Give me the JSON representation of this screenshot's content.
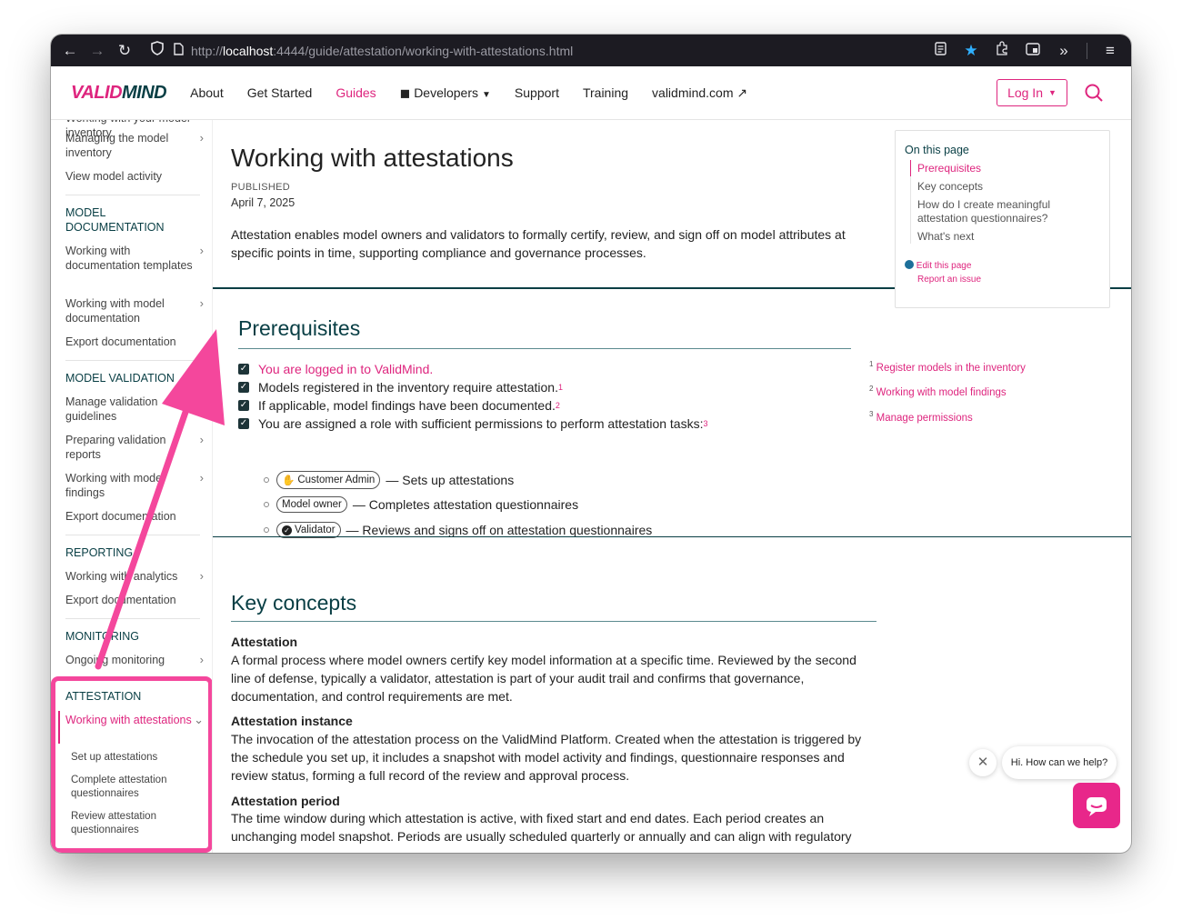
{
  "browser": {
    "url_prefix": "http://",
    "url_host": "localhost",
    "url_rest": ":4444/guide/attestation/working-with-attestations.html"
  },
  "header": {
    "logo_main": "VALID",
    "logo_second": "MIND",
    "nav": {
      "about": "About",
      "get_started": "Get Started",
      "guides": "Guides",
      "developers": "Developers",
      "support": "Support",
      "training": "Training",
      "validmind": "validmind.com"
    },
    "login": "Log In"
  },
  "sidebar": {
    "cut_top": "Working with your model inventory",
    "managing": "Managing the model inventory",
    "view_activity": "View model activity",
    "sec_model_doc": "MODEL DOCUMENTATION",
    "doc_templates": "Working with documentation templates",
    "model_doc": "Working with model documentation",
    "export_doc": "Export documentation",
    "sec_model_val": "MODEL VALIDATION",
    "manage_val": "Manage validation guidelines",
    "preparing": "Preparing validation reports",
    "findings": "Working with model findings",
    "export_doc2": "Export documentation",
    "sec_reporting": "REPORTING",
    "analytics": "Working with analytics",
    "export_doc3": "Export documentation",
    "sec_monitoring": "MONITORING",
    "ongoing": "Ongoing monitoring",
    "sec_attestation": "ATTESTATION",
    "working_att": "Working with attestations",
    "setup_att": "Set up attestations",
    "complete_att": "Complete attestation questionnaires",
    "review_att": "Review attestation questionnaires"
  },
  "main": {
    "title": "Working with attestations",
    "published_label": "PUBLISHED",
    "published_date": "April 7, 2025",
    "intro": "Attestation enables model owners and validators to formally certify, review, and sign off on model attributes at specific points in time, supporting compliance and governance processes.",
    "prereq_title": "Prerequisites",
    "prereq": {
      "logged_in": "You are logged in to ValidMind.",
      "registered": "Models registered in the inventory require attestation.",
      "findings": "If applicable, model findings have been documented.",
      "role": "You are assigned a role with sufficient permissions to perform attestation tasks:",
      "fn1": "1",
      "fn2": "2",
      "fn3": "3"
    },
    "roles": {
      "customer_admin": "Customer Admin",
      "customer_admin_desc": "— Sets up attestations",
      "model_owner": "Model owner",
      "model_owner_desc": "— Completes attestation questionnaires",
      "validator": "Validator",
      "validator_desc": "— Reviews and signs off on attestation questionnaires"
    },
    "footnotes": {
      "n1": "1",
      "t1": "Register models in the inventory",
      "n2": "2",
      "t2": "Working with model findings",
      "n3": "3",
      "t3": "Manage permissions"
    },
    "key_title": "Key concepts",
    "concepts": {
      "attestation_term": "Attestation",
      "attestation_def": "A formal process where model owners certify key model information at a specific time. Reviewed by the second line of defense, typically a validator, attestation is part of your audit trail and confirms that governance, documentation, and control requirements are met.",
      "instance_term": "Attestation instance",
      "instance_def": "The invocation of the attestation process on the ValidMind Platform. Created when the attestation is triggered by the schedule you set up, it includes a snapshot with model activity and findings, questionnaire responses and review status, forming a full record of the review and approval process.",
      "period_term": "Attestation period",
      "period_def": "The time window during which attestation is active, with fixed start and end dates. Each period creates an unchanging model snapshot. Periods are usually scheduled quarterly or annually and can align with regulatory"
    }
  },
  "toc": {
    "title": "On this page",
    "items": {
      "prereq": "Prerequisites",
      "key": "Key concepts",
      "how": "How do I create meaningful attestation questionnaires?",
      "next": "What's next"
    },
    "edit": "Edit this page",
    "report": "Report an issue"
  },
  "chat": {
    "prompt": "Hi. How can we help?"
  },
  "colors": {
    "brand_pink": "#de257e",
    "brand_teal": "#083e44",
    "highlight": "#f4479c"
  }
}
